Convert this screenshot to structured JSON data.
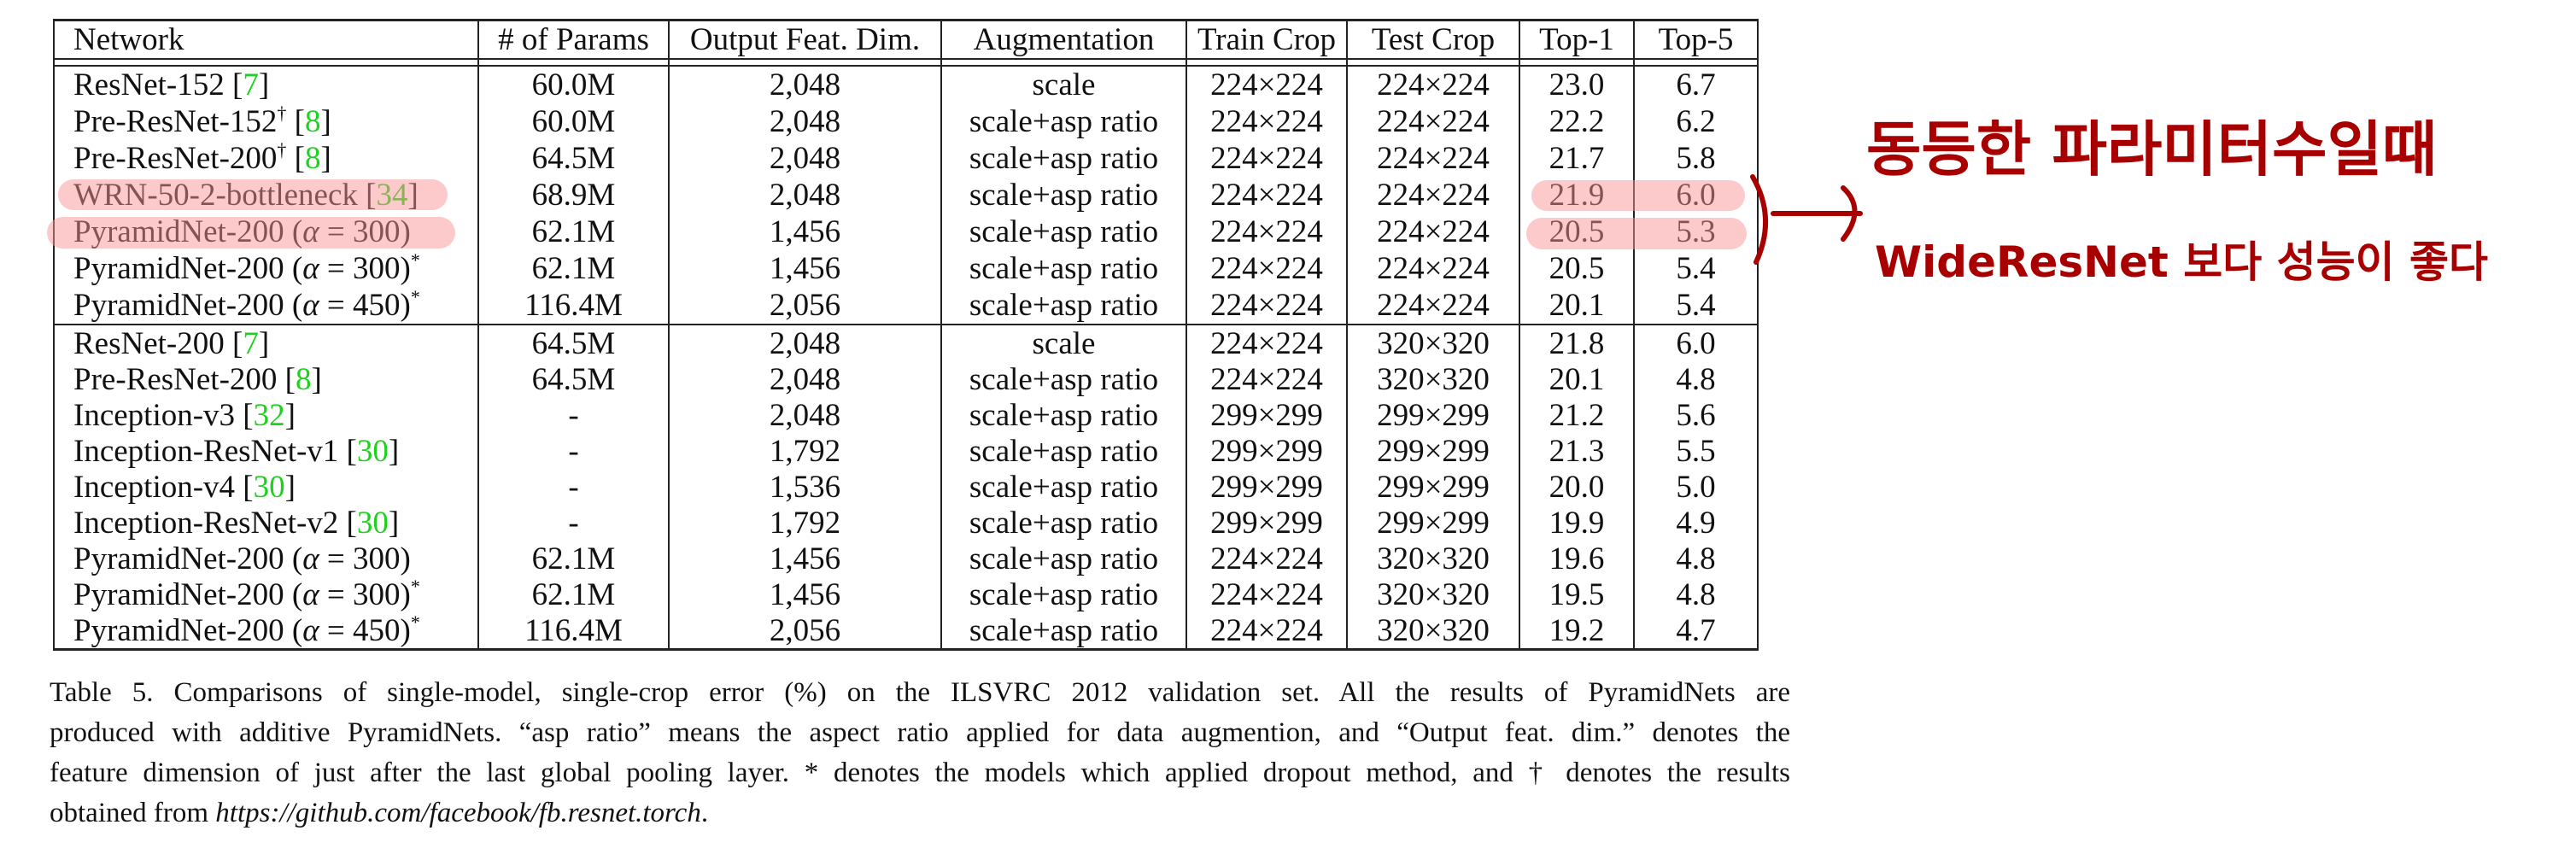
{
  "table": {
    "headers": [
      "Network",
      "# of Params",
      "Output Feat. Dim.",
      "Augmentation",
      "Train Crop",
      "Test Crop",
      "Top-1",
      "Top-5"
    ],
    "sections": [
      [
        {
          "name": "ResNet-152",
          "sup": "",
          "alpha": "",
          "cite": "7",
          "params": "60.0M",
          "dim": "2,048",
          "aug": "scale",
          "train": "224×224",
          "test": "224×224",
          "top1": "23.0",
          "top5": "6.7",
          "bold": false
        },
        {
          "name": "Pre-ResNet-152",
          "sup": "†",
          "alpha": "",
          "cite": "8",
          "params": "60.0M",
          "dim": "2,048",
          "aug": "scale+asp ratio",
          "train": "224×224",
          "test": "224×224",
          "top1": "22.2",
          "top5": "6.2",
          "bold": false
        },
        {
          "name": "Pre-ResNet-200",
          "sup": "†",
          "alpha": "",
          "cite": "8",
          "params": "64.5M",
          "dim": "2,048",
          "aug": "scale+asp ratio",
          "train": "224×224",
          "test": "224×224",
          "top1": "21.7",
          "top5": "5.8",
          "bold": false
        },
        {
          "name": "WRN-50-2-bottleneck",
          "sup": "",
          "alpha": "",
          "cite": "34",
          "params": "68.9M",
          "dim": "2,048",
          "aug": "scale+asp ratio",
          "train": "224×224",
          "test": "224×224",
          "top1": "21.9",
          "top5": "6.0",
          "bold": false
        },
        {
          "name": "PyramidNet-200",
          "sup": "",
          "alpha": "300",
          "cite": "",
          "params": "62.1M",
          "dim": "1,456",
          "aug": "scale+asp ratio",
          "train": "224×224",
          "test": "224×224",
          "top1": "20.5",
          "top5": "5.3",
          "bold": true
        },
        {
          "name": "PyramidNet-200",
          "sup": "*",
          "alpha": "300",
          "cite": "",
          "params": "62.1M",
          "dim": "1,456",
          "aug": "scale+asp ratio",
          "train": "224×224",
          "test": "224×224",
          "top1": "20.5",
          "top5": "5.4",
          "bold": true
        },
        {
          "name": "PyramidNet-200",
          "sup": "*",
          "alpha": "450",
          "cite": "",
          "params": "116.4M",
          "dim": "2,056",
          "aug": "scale+asp ratio",
          "train": "224×224",
          "test": "224×224",
          "top1": "20.1",
          "top5": "5.4",
          "bold": true
        }
      ],
      [
        {
          "name": "ResNet-200",
          "sup": "",
          "alpha": "",
          "cite": "7",
          "params": "64.5M",
          "dim": "2,048",
          "aug": "scale",
          "train": "224×224",
          "test": "320×320",
          "top1": "21.8",
          "top5": "6.0",
          "bold": false
        },
        {
          "name": "Pre-ResNet-200",
          "sup": "",
          "alpha": "",
          "cite": "8",
          "params": "64.5M",
          "dim": "2,048",
          "aug": "scale+asp ratio",
          "train": "224×224",
          "test": "320×320",
          "top1": "20.1",
          "top5": "4.8",
          "bold": false
        },
        {
          "name": "Inception-v3",
          "sup": "",
          "alpha": "",
          "cite": "32",
          "params": "-",
          "dim": "2,048",
          "aug": "scale+asp ratio",
          "train": "299×299",
          "test": "299×299",
          "top1": "21.2",
          "top5": "5.6",
          "bold": false
        },
        {
          "name": "Inception-ResNet-v1",
          "sup": "",
          "alpha": "",
          "cite": "30",
          "params": "-",
          "dim": "1,792",
          "aug": "scale+asp ratio",
          "train": "299×299",
          "test": "299×299",
          "top1": "21.3",
          "top5": "5.5",
          "bold": false
        },
        {
          "name": "Inception-v4",
          "sup": "",
          "alpha": "",
          "cite": "30",
          "params": "-",
          "dim": "1,536",
          "aug": "scale+asp ratio",
          "train": "299×299",
          "test": "299×299",
          "top1": "20.0",
          "top5": "5.0",
          "bold": false
        },
        {
          "name": "Inception-ResNet-v2",
          "sup": "",
          "alpha": "",
          "cite": "30",
          "params": "-",
          "dim": "1,792",
          "aug": "scale+asp ratio",
          "train": "299×299",
          "test": "299×299",
          "top1": "19.9",
          "top5": "4.9",
          "bold": false
        },
        {
          "name": "PyramidNet-200",
          "sup": "",
          "alpha": "300",
          "cite": "",
          "params": "62.1M",
          "dim": "1,456",
          "aug": "scale+asp ratio",
          "train": "224×224",
          "test": "320×320",
          "top1": "19.6",
          "top5": "4.8",
          "bold": true
        },
        {
          "name": "PyramidNet-200",
          "sup": "*",
          "alpha": "300",
          "cite": "",
          "params": "62.1M",
          "dim": "1,456",
          "aug": "scale+asp ratio",
          "train": "224×224",
          "test": "320×320",
          "top1": "19.5",
          "top5": "4.8",
          "bold": true
        },
        {
          "name": "PyramidNet-200",
          "sup": "*",
          "alpha": "450",
          "cite": "",
          "params": "116.4M",
          "dim": "2,056",
          "aug": "scale+asp ratio",
          "train": "224×224",
          "test": "320×320",
          "top1": "19.2",
          "top5": "4.7",
          "bold": true
        }
      ]
    ],
    "alpha_symbol": "α",
    "citation_color": "#1fd11f"
  },
  "caption": {
    "lines": [
      "Table 5. Comparisons of single-model, single-crop error (%) on the ILSVRC 2012 validation set.  All the results of PyramidNets are",
      "produced with additive PyramidNets. “asp ratio” means the aspect ratio applied for data augmention, and “Output feat. dim.” denotes the",
      "feature dimension of just after the last global pooling layer. * denotes the models which applied dropout method, and † denotes the results"
    ],
    "last_prefix": "obtained from ",
    "url": "https://github.com/facebook/fb.resnet.torch",
    "last_suffix": "."
  },
  "annotation": {
    "line1": "동등한 파라미터수일때",
    "line2": "WideResNet 보다 성능이 좋다",
    "color": "#a80000",
    "highlight_color": "#fa9696"
  }
}
